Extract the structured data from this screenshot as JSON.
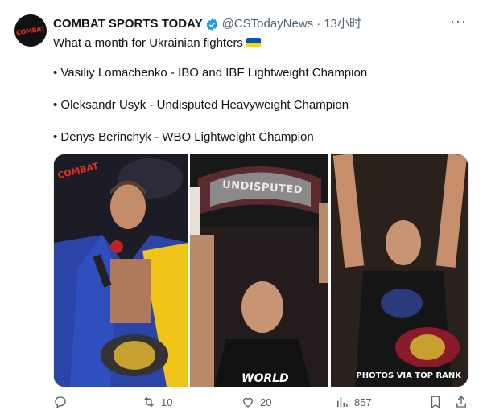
{
  "author": {
    "avatar_text": "COMBAT",
    "display_name": "COMBAT SPORTS TODAY",
    "handle": "@CSTodayNews",
    "separator": "·",
    "time": "13小时"
  },
  "menu": {
    "more_label": "···"
  },
  "tweet": {
    "headline": "What a month for Ukrainian fighters",
    "bullets": [
      "• Vasiliy Lomachenko - IBO and IBF Lightweight Champion",
      "• Oleksandr Usyk - Undisputed Heavyweight Champion",
      "• Denys Berinchyk - WBO Lightweight Champion"
    ]
  },
  "media": {
    "panel1_logo": "COMBAT",
    "panel2_belt_text": "UNDISPUTED",
    "panel2_shirt_text": "WORLD",
    "panel3_credit": "PHOTOS VIA TOP RANK"
  },
  "actions": {
    "replies": "",
    "retweets": "10",
    "likes": "20",
    "views": "857"
  },
  "colors": {
    "verified": "#1d9bf0",
    "muted": "#536471",
    "text": "#0f1419",
    "flag_blue": "#0057b7",
    "flag_yellow": "#ffd700"
  },
  "icons": [
    "verified-badge-icon",
    "more-icon",
    "reply-icon",
    "retweet-icon",
    "like-icon",
    "views-icon",
    "bookmark-icon",
    "share-icon"
  ]
}
